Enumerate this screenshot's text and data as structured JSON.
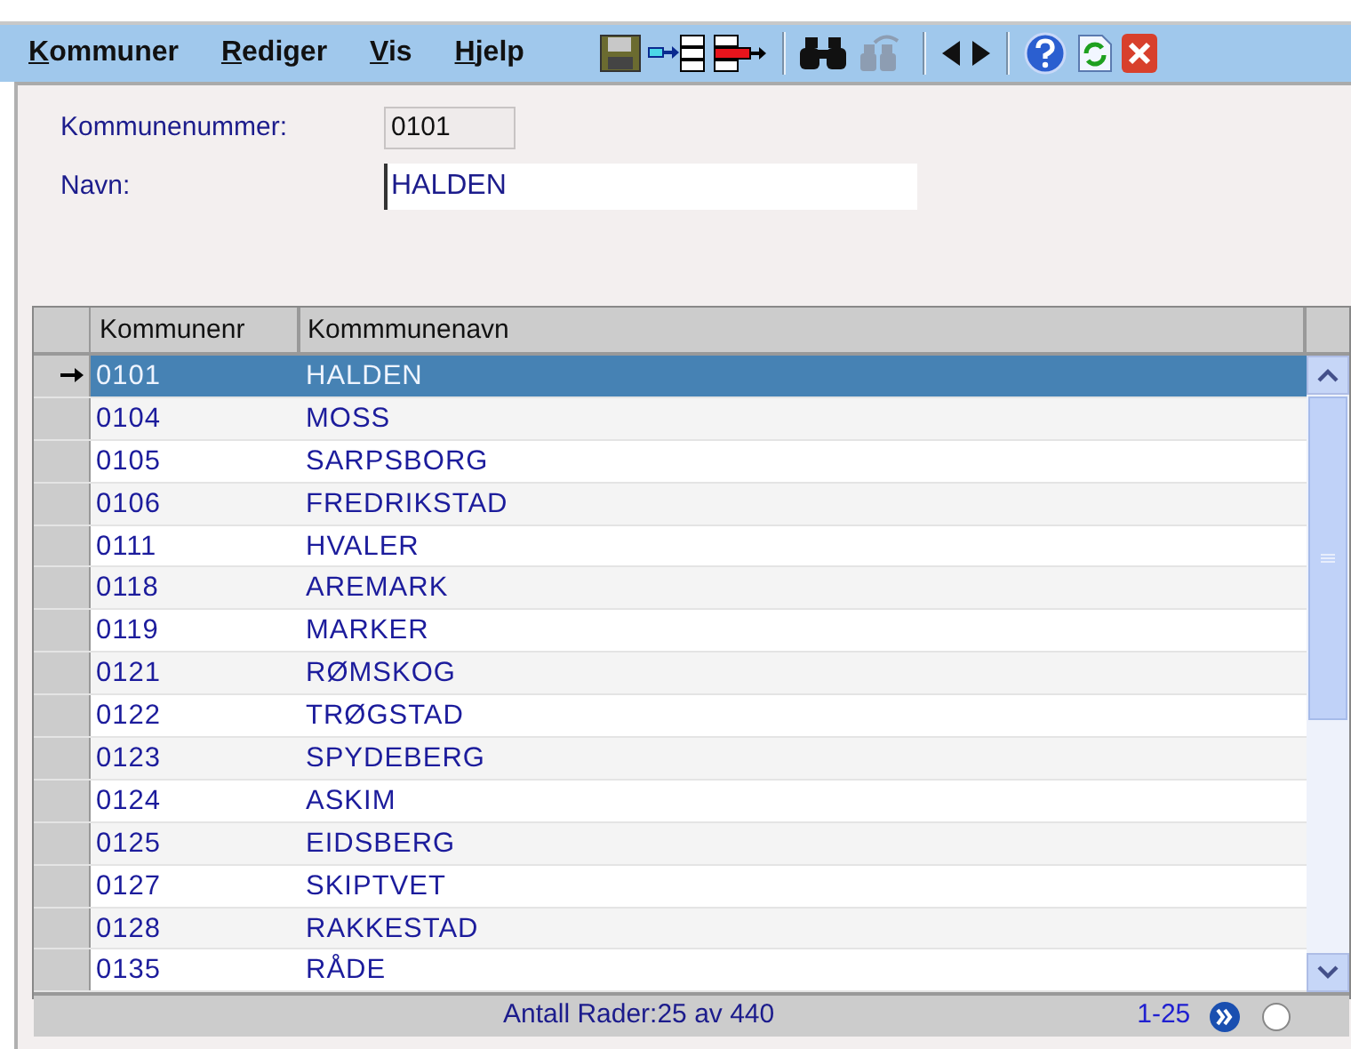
{
  "menu": [
    {
      "label": "Kommuner"
    },
    {
      "label": "Rediger"
    },
    {
      "label": "Vis"
    },
    {
      "label": "Hjelp"
    }
  ],
  "toolbar": [
    {
      "kind": "save",
      "disabled": false
    },
    {
      "kind": "move-in",
      "disabled": false
    },
    {
      "kind": "move-out",
      "disabled": false
    },
    {
      "kind": "sep"
    },
    {
      "kind": "find",
      "disabled": false
    },
    {
      "kind": "find-again",
      "disabled": true
    },
    {
      "kind": "sep"
    },
    {
      "kind": "prev",
      "disabled": false
    },
    {
      "kind": "next",
      "disabled": false
    },
    {
      "kind": "sep"
    },
    {
      "kind": "help",
      "disabled": false
    },
    {
      "kind": "refresh",
      "disabled": false
    },
    {
      "kind": "close",
      "disabled": false
    }
  ],
  "form": {
    "kommunenummer": {
      "label": "Kommunenummer:",
      "value": "0101"
    },
    "navn": {
      "label": "Navn:",
      "value": "HALDEN"
    }
  },
  "table": {
    "columns": [
      "Kommunenr",
      "Kommmunenavn"
    ],
    "rows": [
      {
        "cells": [
          "0101",
          "HALDEN"
        ],
        "selected": true
      },
      {
        "cells": [
          "0104",
          "MOSS"
        ],
        "selected": false
      },
      {
        "cells": [
          "0105",
          "SARPSBORG"
        ],
        "selected": false
      },
      {
        "cells": [
          "0106",
          "FREDRIKSTAD"
        ],
        "selected": false
      },
      {
        "cells": [
          "0111",
          "HVALER"
        ],
        "selected": false
      },
      {
        "cells": [
          "0118",
          "AREMARK"
        ],
        "selected": false
      },
      {
        "cells": [
          "0119",
          "MARKER"
        ],
        "selected": false
      },
      {
        "cells": [
          "0121",
          "RØMSKOG"
        ],
        "selected": false
      },
      {
        "cells": [
          "0122",
          "TRØGSTAD"
        ],
        "selected": false
      },
      {
        "cells": [
          "0123",
          "SPYDEBERG"
        ],
        "selected": false
      },
      {
        "cells": [
          "0124",
          "ASKIM"
        ],
        "selected": false
      },
      {
        "cells": [
          "0125",
          "EIDSBERG"
        ],
        "selected": false
      },
      {
        "cells": [
          "0127",
          "SKIPTVET"
        ],
        "selected": false
      },
      {
        "cells": [
          "0128",
          "RAKKESTAD"
        ],
        "selected": false
      },
      {
        "cells": [
          "0135",
          "RÅDE"
        ],
        "selected": false
      }
    ]
  },
  "status_bar": {
    "row_count": "Antall Rader:25 av 440",
    "range": "1-25",
    "option_checked": false
  }
}
